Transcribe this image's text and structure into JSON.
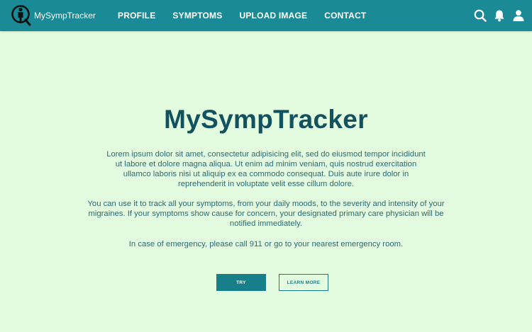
{
  "brand": {
    "name": "MySympTracker",
    "logo_icon": "person-with-magnifier-icon"
  },
  "nav": {
    "items": [
      {
        "label": "PROFILE"
      },
      {
        "label": "SYMPTOMS"
      },
      {
        "label": "UPLOAD IMAGE"
      },
      {
        "label": "CONTACT"
      }
    ]
  },
  "header_icons": [
    "search-icon",
    "bell-icon",
    "user-icon"
  ],
  "hero": {
    "title": "MySympTracker",
    "paragraph1": "Lorem ipsum dolor sit amet, consectetur adipisicing elit, sed do eiusmod tempor incididunt ut labore et dolore magna aliqua. Ut enim ad minim veniam, quis nostrud exercitation ullamco laboris nisi ut aliquip ex ea commodo consequat. Duis aute irure dolor in reprehenderit in voluptate velit esse cillum dolore.",
    "paragraph2": "You can use it to track all your symptoms, from your daily moods, to the severity and intensity of your migraines. If your symptoms show cause for concern, your designated primary care physician will be notified immediately.",
    "paragraph3": "In case of emergency, please call 911 or go to your nearest emergency room.",
    "try_label": "TRY",
    "learn_more_label": "LEARN MORE"
  },
  "colors": {
    "header_bg": "#1a8a96",
    "page_bg": "#e3fbdf",
    "title": "#11525e",
    "text": "#2a6a73",
    "button": "#177f8a"
  }
}
